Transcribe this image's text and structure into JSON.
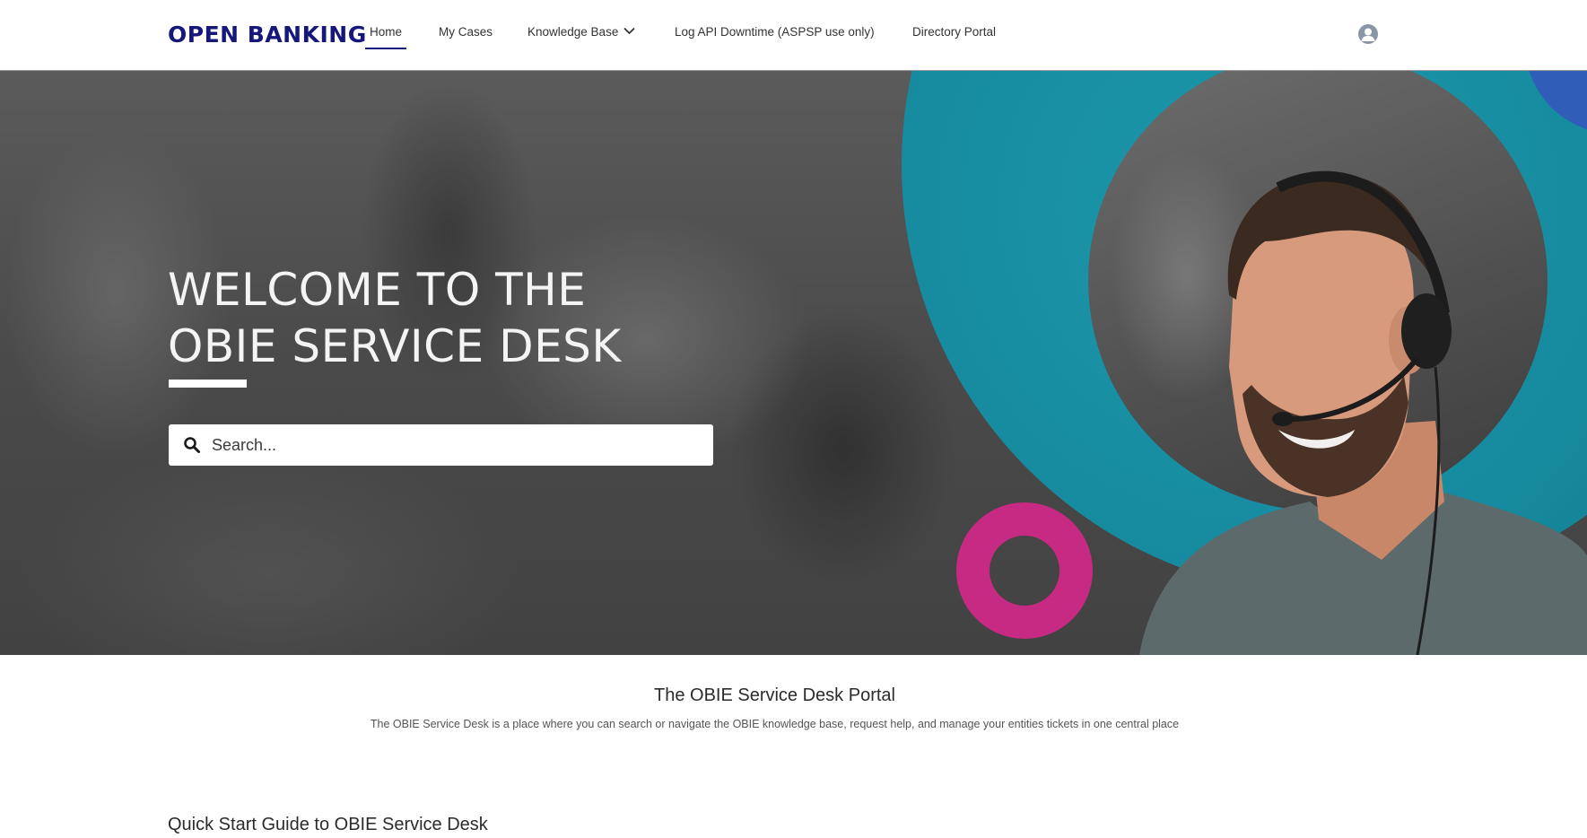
{
  "header": {
    "logo": "OPEN BANKING",
    "nav": [
      {
        "label": "Home",
        "active": true
      },
      {
        "label": "My Cases"
      },
      {
        "label": "Knowledge Base",
        "has_dropdown": true
      },
      {
        "label": "Log API Downtime (ASPSP use only)"
      },
      {
        "label": "Directory Portal"
      }
    ],
    "user_icon": "user-avatar-icon"
  },
  "hero": {
    "title_line1": "WELCOME TO THE",
    "title_line2": "OBIE SERVICE DESK",
    "search": {
      "placeholder": "Search...",
      "value": "",
      "icon": "search-icon"
    }
  },
  "intro": {
    "title": "The OBIE Service Desk Portal",
    "text": "The OBIE Service Desk is a place where you can search or navigate the OBIE knowledge base, request help, and manage your entities tickets in one central place"
  },
  "sections": {
    "quick_start_title": "Quick Start Guide to OBIE Service Desk"
  },
  "colors": {
    "brand": "#15187a",
    "teal": "#168a9e",
    "magenta": "#c72a82",
    "blue": "#2f5db8"
  }
}
